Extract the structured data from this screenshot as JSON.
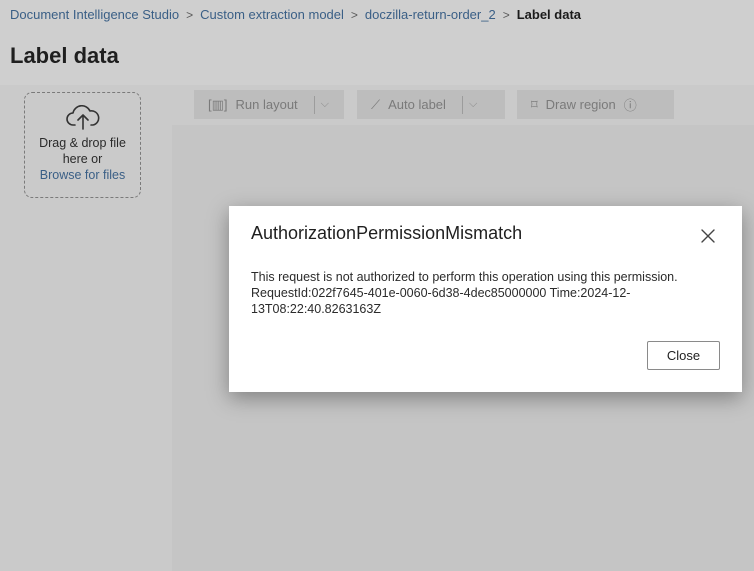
{
  "breadcrumb": {
    "items": [
      "Document Intelligence Studio",
      "Custom extraction model",
      "doczilla-return-order_2"
    ],
    "current": "Label data",
    "separator": ">"
  },
  "page": {
    "title": "Label data"
  },
  "upload": {
    "icon": "cloud-upload-icon",
    "line1": "Drag & drop file",
    "line2": "here or",
    "link": "Browse for files"
  },
  "toolbar": {
    "run_layout": "Run layout",
    "auto_label": "Auto label",
    "draw_region": "Draw region"
  },
  "dialog": {
    "title": "AuthorizationPermissionMismatch",
    "message_line1": "This request is not authorized to perform this operation using this permission.",
    "message_line2": "RequestId:022f7645-401e-0060-6d38-4dec85000000 Time:2024-12-",
    "message_line3": "13T08:22:40.8263163Z",
    "close_label": "Close"
  },
  "colors": {
    "link": "#3a5f86",
    "overlay": "#cfcfcf"
  }
}
